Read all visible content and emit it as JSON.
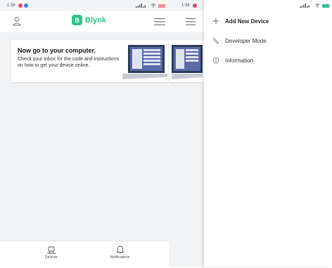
{
  "left_status": {
    "time": "1:36"
  },
  "right_status": {
    "time": "1:36"
  },
  "app": {
    "logo_letter": "B",
    "logo_text": "Blynk",
    "accent": "#2fc48d"
  },
  "card": {
    "title": "Now go to your computer.",
    "body": "Check your inbox for the code and instructions on how to get your device online."
  },
  "bottom_nav": {
    "tab_devices": "Devices",
    "tab_notifications": "Notifications"
  },
  "drawer": {
    "items": [
      {
        "icon": "plus-icon",
        "label": "Add New Device"
      },
      {
        "icon": "wrench-icon",
        "label": "Developer Mode"
      },
      {
        "icon": "info-icon",
        "label": "Information"
      }
    ]
  },
  "colors": {
    "background": "#f3f4f6",
    "battery": "#f08b93"
  }
}
